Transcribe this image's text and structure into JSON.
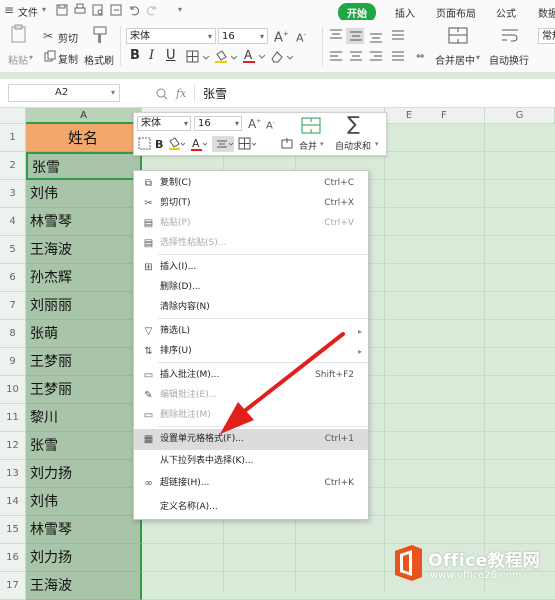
{
  "menubar": {
    "menu_icon": "≡",
    "file_label": "文件",
    "tabs": [
      "开始",
      "插入",
      "页面布局",
      "公式",
      "数据"
    ],
    "active_tab": "开始"
  },
  "ribbon": {
    "paste_label": "粘贴",
    "cut_label": "剪切",
    "copy_label": "复制",
    "format_painter_label": "格式刷",
    "font_name": "宋体",
    "font_size": "16",
    "merge_label": "合并居中",
    "wrap_label": "自动换行",
    "normal_label": "常规"
  },
  "formula_bar": {
    "name_box": "A2",
    "fx_label": "fx",
    "value": "张雪"
  },
  "grid": {
    "columns": [
      "A",
      "E",
      "F",
      "G"
    ],
    "header_cell": "姓名",
    "rows": [
      {
        "num": "1",
        "value": "姓名"
      },
      {
        "num": "2",
        "value": "张雪"
      },
      {
        "num": "3",
        "value": "刘伟"
      },
      {
        "num": "4",
        "value": "林雪琴"
      },
      {
        "num": "5",
        "value": "王海波"
      },
      {
        "num": "6",
        "value": "孙杰辉"
      },
      {
        "num": "7",
        "value": "刘丽丽"
      },
      {
        "num": "8",
        "value": "张萌"
      },
      {
        "num": "9",
        "value": "王梦丽"
      },
      {
        "num": "10",
        "value": "王梦丽"
      },
      {
        "num": "11",
        "value": "黎川"
      },
      {
        "num": "12",
        "value": "张雪"
      },
      {
        "num": "13",
        "value": "刘力扬"
      },
      {
        "num": "14",
        "value": "刘伟"
      },
      {
        "num": "15",
        "value": "林雪琴"
      },
      {
        "num": "16",
        "value": "刘力扬"
      },
      {
        "num": "17",
        "value": "王海波"
      }
    ]
  },
  "mini_toolbar": {
    "font_name": "宋体",
    "font_size": "16",
    "merge_label": "合并",
    "autosum_label": "自动求和"
  },
  "context_menu": {
    "items": [
      {
        "icon": "copy-icon",
        "label": "复制(C)",
        "shortcut": "Ctrl+C",
        "disabled": false
      },
      {
        "icon": "scissors-icon",
        "label": "剪切(T)",
        "shortcut": "Ctrl+X",
        "disabled": false
      },
      {
        "icon": "paste-icon",
        "label": "粘贴(P)",
        "shortcut": "Ctrl+V",
        "disabled": true
      },
      {
        "icon": "paste-special-icon",
        "label": "选择性粘贴(S)...",
        "shortcut": "",
        "disabled": true
      },
      {
        "icon": "insert-icon",
        "label": "插入(I)...",
        "shortcut": "",
        "disabled": false
      },
      {
        "icon": "",
        "label": "删除(D)...",
        "shortcut": "",
        "disabled": false
      },
      {
        "icon": "",
        "label": "清除内容(N)",
        "shortcut": "",
        "disabled": false
      },
      {
        "icon": "filter-icon",
        "label": "筛选(L)",
        "shortcut": "",
        "disabled": false
      },
      {
        "icon": "sort-icon",
        "label": "排序(U)",
        "shortcut": "",
        "disabled": false
      },
      {
        "icon": "comment-icon",
        "label": "插入批注(M)...",
        "shortcut": "Shift+F2",
        "disabled": false
      },
      {
        "icon": "edit-comment-icon",
        "label": "编辑批注(E)...",
        "shortcut": "",
        "disabled": true
      },
      {
        "icon": "delete-comment-icon",
        "label": "删除批注(M)",
        "shortcut": "",
        "disabled": true
      },
      {
        "icon": "format-cells-icon",
        "label": "设置单元格格式(F)...",
        "shortcut": "Ctrl+1",
        "disabled": false
      },
      {
        "icon": "",
        "label": "从下拉列表中选择(K)...",
        "shortcut": "",
        "disabled": false
      },
      {
        "icon": "link-icon",
        "label": "超链接(H)...",
        "shortcut": "Ctrl+K",
        "disabled": false
      },
      {
        "icon": "",
        "label": "定义名称(A)...",
        "shortcut": "",
        "disabled": false
      }
    ]
  },
  "watermark": {
    "brand": "Office教程网",
    "url": "www.office26.com"
  },
  "colors": {
    "accent_green": "#22a545",
    "header_fill": "#f2a86a",
    "arrow_red": "#e0201b",
    "logo_orange": "#e8541c"
  }
}
